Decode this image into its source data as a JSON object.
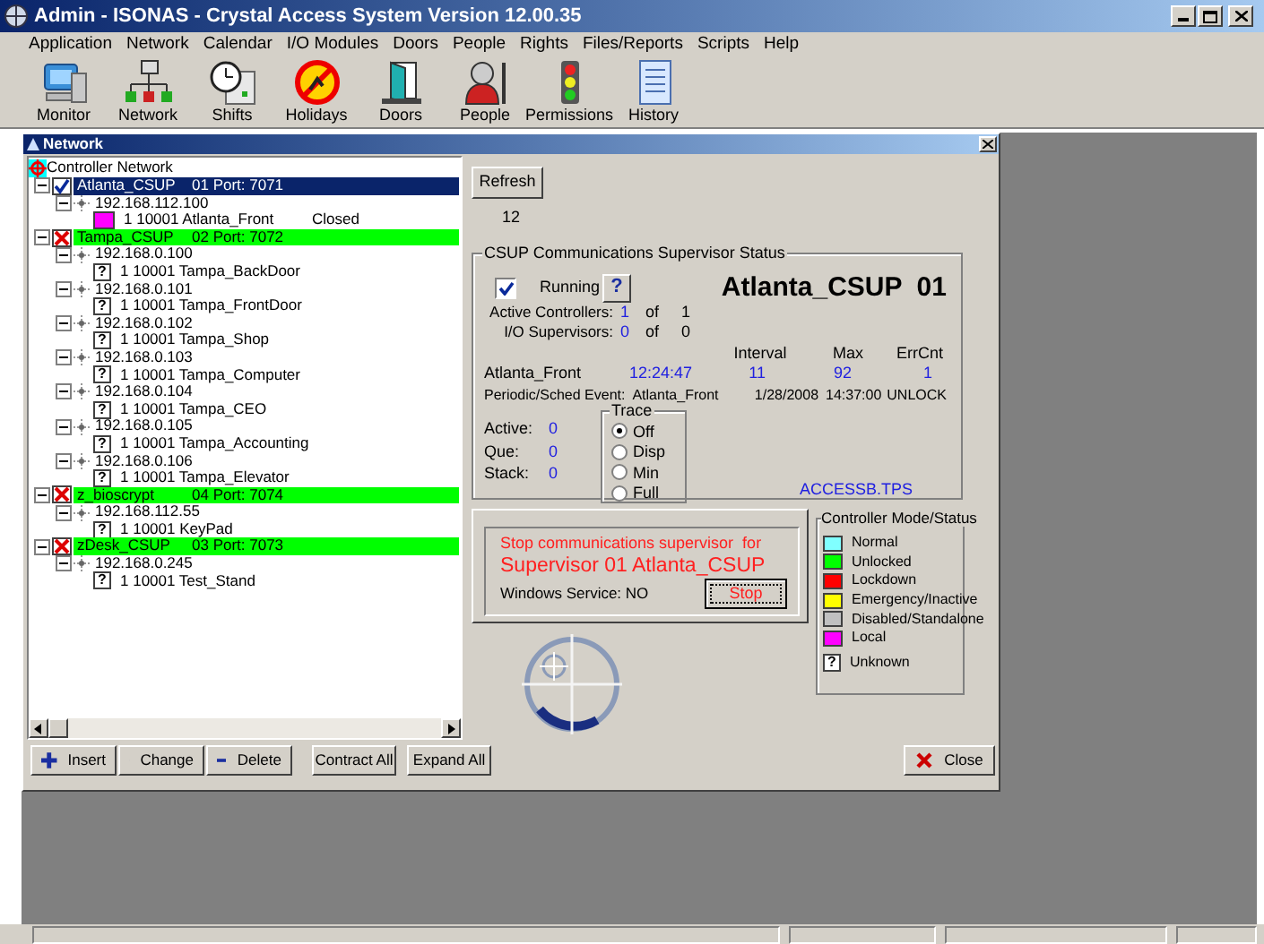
{
  "app_title": "Admin - ISONAS - Crystal Access System Version 12.00.35",
  "menu": [
    "Application",
    "Network",
    "Calendar",
    "I/O Modules",
    "Doors",
    "People",
    "Rights",
    "Files/Reports",
    "Scripts",
    "Help"
  ],
  "toolbar": [
    "Monitor",
    "Network",
    "Shifts",
    "Holidays",
    "Doors",
    "People",
    "Permissions",
    "History"
  ],
  "network_window": {
    "title": "Network",
    "tree": {
      "root": "Controller Network",
      "controllers": [
        {
          "name": "Atlanta_CSUP",
          "port": "01 Port: 7071",
          "kind": "running",
          "selected": true,
          "expanded": true,
          "children": [
            {
              "address": "192.168.112.100",
              "expanded": true,
              "children": [
                {
                  "label": "1 10001 Atlanta_Front",
                  "state": "Closed",
                  "kind": "local"
                }
              ]
            }
          ]
        },
        {
          "name": "Tampa_CSUP",
          "port": "02 Port: 7072",
          "kind": "stopped",
          "selected": false,
          "expanded": true,
          "children": [
            {
              "address": "192.168.0.100",
              "expanded": true,
              "children": [
                {
                  "label": "1 10001 Tampa_BackDoor",
                  "kind": "unknown",
                  "badge": "?"
                }
              ]
            },
            {
              "address": "192.168.0.101",
              "expanded": true,
              "children": [
                {
                  "label": "1 10001 Tampa_FrontDoor",
                  "kind": "unknown",
                  "badge": "?"
                }
              ]
            },
            {
              "address": "192.168.0.102",
              "expanded": true,
              "children": [
                {
                  "label": "1 10001 Tampa_Shop",
                  "kind": "unknown",
                  "badge": "?"
                }
              ]
            },
            {
              "address": "192.168.0.103",
              "expanded": true,
              "children": [
                {
                  "label": "1 10001 Tampa_Computer",
                  "kind": "unknown",
                  "badge": "?"
                }
              ]
            },
            {
              "address": "192.168.0.104",
              "expanded": true,
              "children": [
                {
                  "label": "1 10001 Tampa_CEO",
                  "kind": "unknown",
                  "badge": "?"
                }
              ]
            },
            {
              "address": "192.168.0.105",
              "expanded": true,
              "children": [
                {
                  "label": "1 10001 Tampa_Accounting",
                  "kind": "unknown",
                  "badge": "?"
                }
              ]
            },
            {
              "address": "192.168.0.106",
              "expanded": true,
              "children": [
                {
                  "label": "1 10001 Tampa_Elevator",
                  "kind": "unknown",
                  "badge": "?"
                }
              ]
            }
          ]
        },
        {
          "name": "z_bioscrypt",
          "port": "04 Port: 7074",
          "kind": "stopped",
          "selected": false,
          "expanded": true,
          "children": [
            {
              "address": "192.168.112.55",
              "expanded": true,
              "children": [
                {
                  "label": "1 10001 KeyPad",
                  "kind": "unknown",
                  "badge": "?"
                }
              ]
            }
          ]
        },
        {
          "name": "zDesk_CSUP",
          "port": "03 Port: 7073",
          "kind": "stopped",
          "selected": false,
          "expanded": true,
          "children": [
            {
              "address": "192.168.0.245",
              "expanded": true,
              "children": [
                {
                  "label": "1 10001 Test_Stand",
                  "kind": "unknown",
                  "badge": "?"
                }
              ]
            }
          ]
        }
      ]
    },
    "refresh_button": "Refresh",
    "count": "12",
    "status_group": {
      "title": "CSUP Communications Supervisor Status",
      "running": {
        "label": "Running",
        "checked": true
      },
      "help_button": "?",
      "heading": "Atlanta_CSUP  01",
      "active_controllers": {
        "label": "Active Controllers:",
        "value": "1",
        "of": "of",
        "total": "1"
      },
      "io_supervisors": {
        "label": "I/O Supervisors:",
        "value": "0",
        "of": "of",
        "total": "0"
      },
      "columns": [
        "Interval",
        "Max",
        "ErrCnt"
      ],
      "door_row": {
        "name": "Atlanta_Front",
        "time": "12:24:47",
        "interval": "11",
        "max": "92",
        "errcnt": "1"
      },
      "event_row": {
        "label": "Periodic/Sched Event:",
        "door": "Atlanta_Front",
        "date": "1/28/2008",
        "time": "14:37:00",
        "action": "UNLOCK"
      },
      "counters": [
        {
          "label": "Active:",
          "value": "0"
        },
        {
          "label": "Que:",
          "value": "0"
        },
        {
          "label": "Stack:",
          "value": "0"
        }
      ],
      "trace": {
        "title": "Trace",
        "options": [
          {
            "label": "Off",
            "selected": true
          },
          {
            "label": "Disp",
            "selected": false
          },
          {
            "label": "Min",
            "selected": false
          },
          {
            "label": "Full",
            "selected": false
          }
        ]
      },
      "file": "ACCESSB.TPS"
    },
    "stop_panel": {
      "line1": "Stop communications supervisor  for",
      "line2": "Supervisor 01 Atlanta_CSUP",
      "service": "Windows Service: NO",
      "button": "Stop"
    },
    "legend": {
      "title": "Controller Mode/Status",
      "items": [
        {
          "label": "Normal",
          "kind": "swatch",
          "color": "#80ffff"
        },
        {
          "label": "Unlocked",
          "kind": "swatch",
          "color": "#00ff00"
        },
        {
          "label": "Lockdown",
          "kind": "swatch",
          "color": "#ff0000"
        },
        {
          "label": "Emergency/Inactive",
          "kind": "swatch",
          "color": "#ffff00"
        },
        {
          "label": "Disabled/Standalone",
          "kind": "swatch",
          "color": "#c0c0c0"
        },
        {
          "label": "Local",
          "kind": "swatch",
          "color": "#ff00ff"
        },
        {
          "label": "Unknown",
          "kind": "unknown",
          "badge": "?"
        }
      ]
    },
    "buttons": [
      {
        "label": "Insert",
        "kind": "insert"
      },
      {
        "label": "Change",
        "kind": "change"
      },
      {
        "label": "Delete",
        "kind": "delete"
      },
      {
        "label": "Contract All",
        "kind": "plain"
      },
      {
        "label": "Expand All",
        "kind": "plain"
      }
    ],
    "close_button": "Close"
  }
}
